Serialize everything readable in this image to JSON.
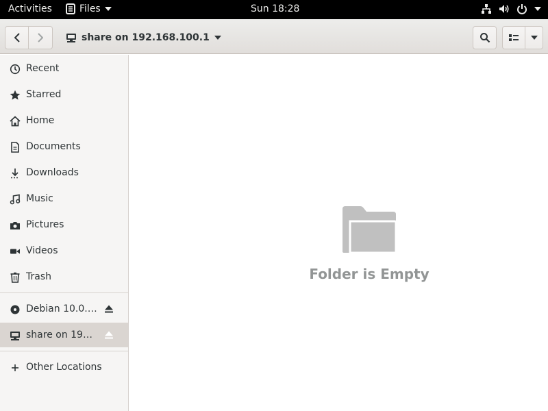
{
  "topbar": {
    "activities": "Activities",
    "app_name": "Files",
    "clock": "Sun 18:28"
  },
  "header": {
    "location": "share on 192.168.100.1"
  },
  "sidebar": {
    "places": [
      {
        "label": "Recent",
        "icon": "clock-icon"
      },
      {
        "label": "Starred",
        "icon": "star-icon"
      },
      {
        "label": "Home",
        "icon": "home-icon"
      },
      {
        "label": "Documents",
        "icon": "document-icon"
      },
      {
        "label": "Downloads",
        "icon": "download-icon"
      },
      {
        "label": "Music",
        "icon": "music-icon"
      },
      {
        "label": "Pictures",
        "icon": "camera-icon"
      },
      {
        "label": "Videos",
        "icon": "video-icon"
      },
      {
        "label": "Trash",
        "icon": "trash-icon"
      }
    ],
    "devices": [
      {
        "label": "Debian 10.0.0...",
        "icon": "disc-icon"
      },
      {
        "label": "share on 192....",
        "icon": "network-share-icon"
      }
    ],
    "other": {
      "label": "Other Locations",
      "icon": "plus-icon"
    }
  },
  "main": {
    "empty_message": "Folder is Empty"
  }
}
